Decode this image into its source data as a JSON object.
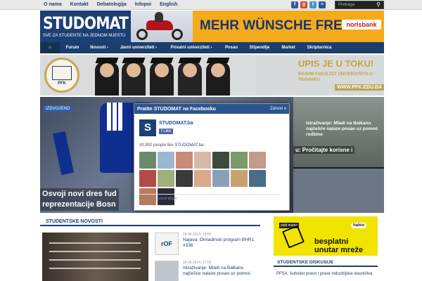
{
  "topbar": {
    "links": [
      "O nama",
      "Kontakt",
      "Debatologija",
      "Infopoi",
      "English"
    ],
    "search_placeholder": "Pretraga",
    "social": [
      "facebook-icon",
      "google-plus-icon",
      "twitter-icon",
      "rss-icon"
    ]
  },
  "header": {
    "logo": "STUDOMAT",
    "tagline": "SVE ZA STUDENTE NA JEDNOM MJESTU",
    "ad_text": "MEHR WÜNSCHE FREI!",
    "ad_brand": "norisbank"
  },
  "nav": {
    "items": [
      "Forum",
      "Novosti ›",
      "Javni univerziteti ›",
      "Privatni univerziteti ›",
      "Posao",
      "Stipendije",
      "Market",
      "Skriptarnica"
    ]
  },
  "hero": {
    "seal": "PFK",
    "headline": "UPIS JE U TOKU!",
    "subline": "PRAVNI FAKULTET UNIVERZITETA U TRAVNIKU",
    "url": "WWW.PFK.EDU.BA"
  },
  "slider": {
    "badge": "IZDVOJENO",
    "title_line1": "Osvoji novi dres fud",
    "title_line2": "reprezentacije Bosn",
    "right_top": "u: Pročitajte korisne i",
    "right_bottom": "Istraživanje: Mladi na Balkanu najčešće nalaze posao uz pomoć rodbine"
  },
  "modal": {
    "title": "Pratite STUDOMAT na Facebooku",
    "close": "Zatvori x",
    "page_name": "STUDOMAT.ba",
    "like_button": "Like",
    "count_text": "43,892 people like",
    "count_link": "STUDOMAT.ba.",
    "plugin_text": "Facebook social plugin",
    "faces": [
      "#6b8a6a",
      "#9cb8d0",
      "#c98a7a",
      "#d8b9a9",
      "#3b4a3a",
      "#7a9a6a",
      "#c59a8a",
      "#b34a4a",
      "#a0b07a",
      "#3a3a3a",
      "#d9a98c",
      "#8aa0b8",
      "#c9a070",
      "#4a6a8a",
      "#b87a5a",
      "#2a2a3a"
    ]
  },
  "news": {
    "heading": "STUDENTSKE NOVOSTI",
    "items": [
      {
        "date": "18.06.2014. 10:00",
        "title": "Najava: Omladinski program BHR1 #336"
      },
      {
        "date": "18.06.2014. 17:00",
        "title": "Istraživanje: Mladi na Balkanu najčešće nalaze posao uz pomoć"
      }
    ]
  },
  "sidebar": {
    "ad_line1": "besplatni",
    "ad_line2": "unutar mreže",
    "ad_tag": "plati manje",
    "ad_brand": "haloo",
    "heading": "STUDENTSKE DISKUSIJE",
    "text": "PFSA: Autosko pravo i prave industrijska vlasništva"
  }
}
